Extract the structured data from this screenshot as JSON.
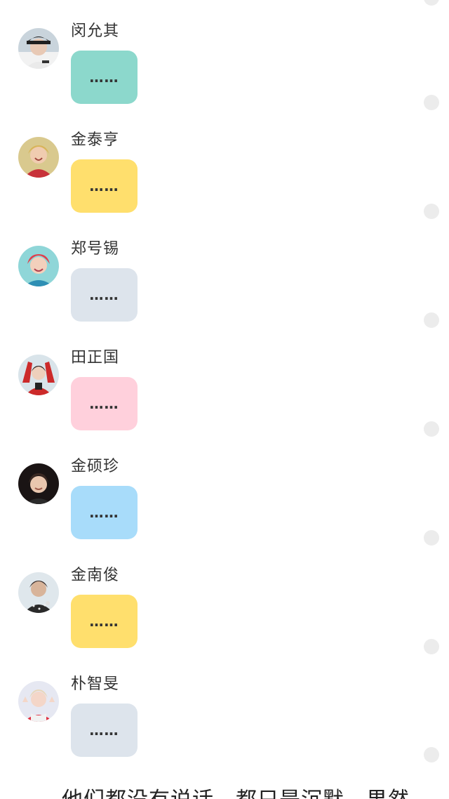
{
  "messages": [
    {
      "name": "闵允其",
      "text": "……",
      "bubble_color": "#8cd8cc",
      "avatar": "avatar-yoongi"
    },
    {
      "name": "金泰亨",
      "text": "……",
      "bubble_color": "#ffdf6d",
      "avatar": "avatar-taehyung"
    },
    {
      "name": "郑号锡",
      "text": "……",
      "bubble_color": "#dde4ec",
      "avatar": "avatar-hoseok"
    },
    {
      "name": "田正国",
      "text": "……",
      "bubble_color": "#ffd0dc",
      "avatar": "avatar-jungkook"
    },
    {
      "name": "金硕珍",
      "text": "……",
      "bubble_color": "#a8dcfa",
      "avatar": "avatar-seokjin"
    },
    {
      "name": "金南俊",
      "text": "……",
      "bubble_color": "#ffdf6d",
      "avatar": "avatar-namjoon"
    },
    {
      "name": "朴智旻",
      "text": "……",
      "bubble_color": "#dde4ec",
      "avatar": "avatar-jimin"
    }
  ],
  "footer": {
    "text": "他们都没有说话，都只是沉默，果然"
  }
}
